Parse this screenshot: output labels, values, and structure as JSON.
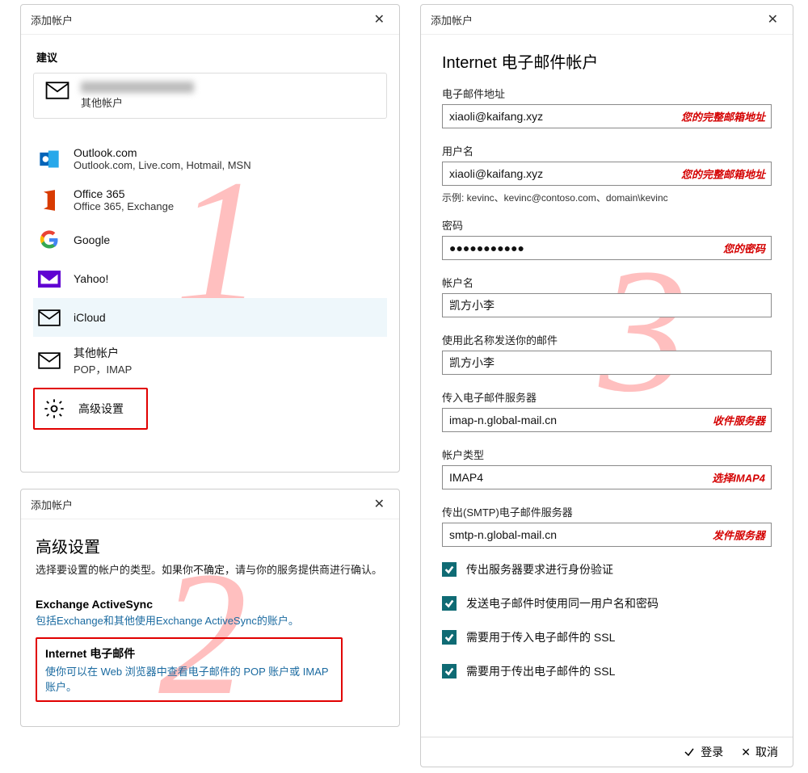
{
  "nums": {
    "one": "1",
    "two": "2",
    "three": "3"
  },
  "p1": {
    "title": "添加帐户",
    "suggest": "建议",
    "suggest_sub": "其他帐户",
    "providers": [
      {
        "name": "Outlook.com",
        "sub": "Outlook.com, Live.com, Hotmail, MSN"
      },
      {
        "name": "Office 365",
        "sub": "Office 365, Exchange"
      },
      {
        "name": "Google",
        "sub": ""
      },
      {
        "name": "Yahoo!",
        "sub": ""
      },
      {
        "name": "iCloud",
        "sub": ""
      },
      {
        "name": "其他帐户",
        "sub": "POP，IMAP"
      },
      {
        "name": "高级设置",
        "sub": ""
      }
    ]
  },
  "p2": {
    "title": "添加帐户",
    "heading": "高级设置",
    "desc_a": "选择要设置的帐户的类型。如果你",
    "desc_b": "不确定",
    "desc_c": "，请与你的服务提供商进行确认。",
    "opt1_t": "Exchange ActiveSync",
    "opt1_s": "包括Exchange和其他使用Exchange ActiveSync的账户。",
    "opt2_t": "Internet 电子邮件",
    "opt2_s": "使你可以在 Web 浏览器中查看电子邮件的 POP 账户或 IMAP 账户。"
  },
  "p3": {
    "title": "添加帐户",
    "heading": "Internet 电子邮件帐户",
    "f_email_l": "电子邮件地址",
    "f_email_v": "xiaoli@kaifang.xyz",
    "f_email_h": "您的完整邮箱地址",
    "f_user_l": "用户名",
    "f_user_v": "xiaoli@kaifang.xyz",
    "f_user_h": "您的完整邮箱地址",
    "example": "示例: kevinc、kevinc@contoso.com、domain\\kevinc",
    "f_pass_l": "密码",
    "f_pass_v": "●●●●●●●●●●●",
    "f_pass_h": "您的密码",
    "f_acct_l": "帐户名",
    "f_acct_v": "凯方小李",
    "f_send_l": "使用此名称发送你的邮件",
    "f_send_v": "凯方小李",
    "f_in_l": "传入电子邮件服务器",
    "f_in_v": "imap-n.global-mail.cn",
    "f_in_h": "收件服务器",
    "f_type_l": "帐户类型",
    "f_type_v": "IMAP4",
    "f_type_h": "选择IMAP4",
    "f_out_l": "传出(SMTP)电子邮件服务器",
    "f_out_v": "smtp-n.global-mail.cn",
    "f_out_h": "发件服务器",
    "chk1": "传出服务器要求进行身份验证",
    "chk2": "发送电子邮件时使用同一用户名和密码",
    "chk3": "需要用于传入电子邮件的 SSL",
    "chk4": "需要用于传出电子邮件的 SSL",
    "login": "登录",
    "cancel": "取消"
  }
}
